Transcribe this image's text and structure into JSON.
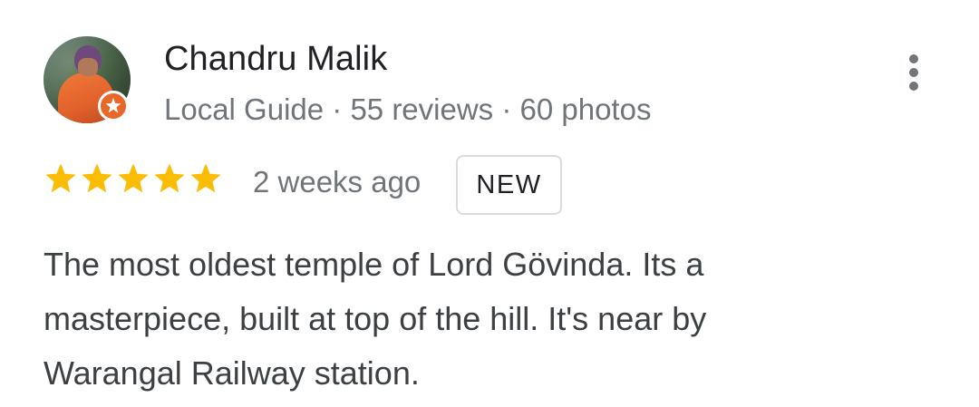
{
  "reviewer": {
    "name": "Chandru Malik",
    "meta": "Local Guide · 55 reviews · 60 photos",
    "avatar_icon": "person-photo",
    "badge_icon": "local-guide-star-icon",
    "badge_color": "#e8682a"
  },
  "menu": {
    "icon": "more-vert-icon"
  },
  "rating": {
    "stars": 5,
    "max_stars": 5,
    "star_color": "#fbbc04",
    "time": "2 weeks ago",
    "badge": "NEW"
  },
  "review": {
    "lines": [
      "The most oldest temple of Lord Gövinda. Its a",
      "masterpiece, built at top of the hill. It's near by",
      "Warangal Railway station."
    ]
  }
}
